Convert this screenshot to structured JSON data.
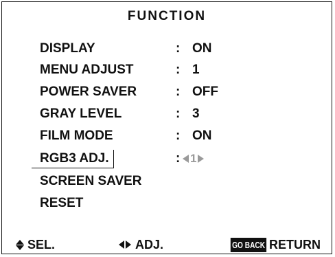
{
  "menu": {
    "title": "FUNCTION",
    "items": [
      {
        "label": "DISPLAY",
        "colon": ":",
        "value": "ON"
      },
      {
        "label": "MENU ADJUST",
        "colon": ":",
        "value": "1"
      },
      {
        "label": "POWER SAVER",
        "colon": ":",
        "value": "OFF"
      },
      {
        "label": "GRAY LEVEL",
        "colon": ":",
        "value": "3"
      },
      {
        "label": "FILM MODE",
        "colon": ":",
        "value": "ON"
      },
      {
        "label": "RGB3 ADJ.",
        "colon": ":",
        "value": "1"
      },
      {
        "label": "SCREEN SAVER"
      },
      {
        "label": "RESET"
      }
    ],
    "selected_item": "RGB3 ADJ."
  },
  "footer": {
    "sel_label": "SEL.",
    "adj_label": "ADJ.",
    "goback_key": "GO BACK",
    "return_label": "RETURN"
  },
  "colors": {
    "text": "#111111",
    "disabled_value": "#9a9a9a",
    "background": "#ffffff"
  }
}
